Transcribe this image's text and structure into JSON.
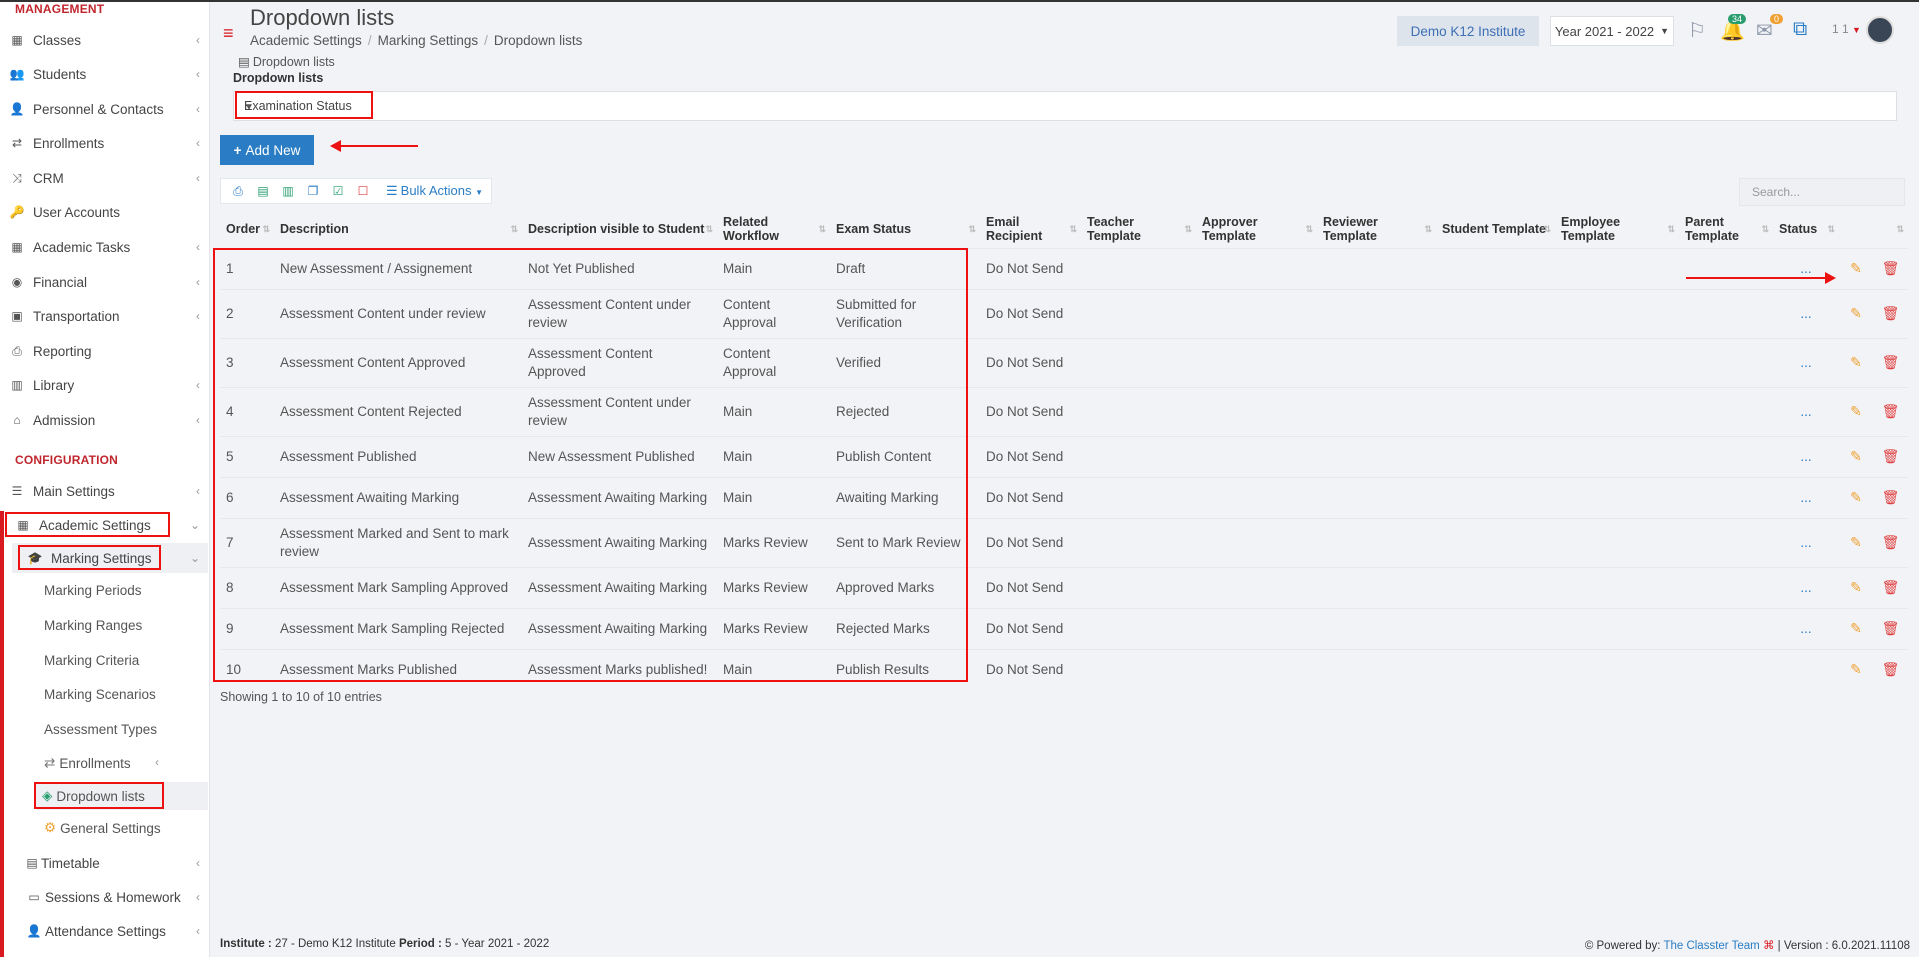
{
  "sidebar": {
    "management_title": "MANAGEMENT",
    "configuration_title": "CONFIGURATION",
    "items": [
      {
        "label": "Classes"
      },
      {
        "label": "Students"
      },
      {
        "label": "Personnel & Contacts"
      },
      {
        "label": "Enrollments"
      },
      {
        "label": "CRM"
      },
      {
        "label": "User Accounts"
      },
      {
        "label": "Academic Tasks"
      },
      {
        "label": "Financial"
      },
      {
        "label": "Transportation"
      },
      {
        "label": "Reporting"
      },
      {
        "label": "Library"
      },
      {
        "label": "Admission"
      }
    ],
    "config_items": [
      {
        "label": "Main Settings"
      },
      {
        "label": "Academic Settings"
      },
      {
        "label": "Marking Settings"
      },
      {
        "label": "Marking Periods"
      },
      {
        "label": "Marking Ranges"
      },
      {
        "label": "Marking Criteria"
      },
      {
        "label": "Marking Scenarios"
      },
      {
        "label": "Assessment Types"
      },
      {
        "label": "Enrollments"
      },
      {
        "label": "Dropdown lists"
      },
      {
        "label": "General Settings"
      },
      {
        "label": "Timetable"
      },
      {
        "label": "Sessions & Homework"
      },
      {
        "label": "Attendance Settings"
      }
    ]
  },
  "header": {
    "title": "Dropdown lists",
    "breadcrumb": [
      "Academic Settings",
      "Marking Settings",
      "Dropdown lists"
    ],
    "institute": "Demo K12 Institute",
    "year": "Year 2021 - 2022",
    "notifications_count": "34",
    "messages_count": "0",
    "user_number": "1 1"
  },
  "content": {
    "subhead": "Dropdown lists",
    "dropdown_label": "Dropdown lists",
    "dropdown_value": "Examination Status",
    "add_button": "Add New",
    "bulk_actions": "Bulk Actions",
    "search_placeholder": "Search...",
    "showing": "Showing 1 to 10 of 10 entries"
  },
  "table": {
    "columns": [
      "Order",
      "Description",
      "Description visible to Student",
      "Related Workflow",
      "Exam Status",
      "Email Recipient",
      "Teacher Template",
      "Approver Template",
      "Reviewer Template",
      "Student Template",
      "Employee Template",
      "Parent Template",
      "Status"
    ],
    "rows": [
      {
        "order": "1",
        "desc": "New Assessment / Assignement",
        "visible": "Not Yet Published",
        "workflow": "Main",
        "status": "Draft",
        "email": "Do Not Send",
        "dots": "..."
      },
      {
        "order": "2",
        "desc": "Assessment Content under review",
        "visible": "Assessment Content under review",
        "workflow": "Content Approval",
        "status": "Submitted for Verification",
        "email": "Do Not Send",
        "dots": "..."
      },
      {
        "order": "3",
        "desc": "Assessment Content Approved",
        "visible": "Assessment Content Approved",
        "workflow": "Content Approval",
        "status": "Verified",
        "email": "Do Not Send",
        "dots": "..."
      },
      {
        "order": "4",
        "desc": "Assessment Content Rejected",
        "visible": "Assessment Content under review",
        "workflow": "Main",
        "status": "Rejected",
        "email": "Do Not Send",
        "dots": "..."
      },
      {
        "order": "5",
        "desc": "Assessment Published",
        "visible": "New Assessment Published",
        "workflow": "Main",
        "status": "Publish Content",
        "email": "Do Not Send",
        "dots": "..."
      },
      {
        "order": "6",
        "desc": "Assessment Awaiting Marking",
        "visible": "Assessment Awaiting Marking",
        "workflow": "Main",
        "status": "Awaiting Marking",
        "email": "Do Not Send",
        "dots": "..."
      },
      {
        "order": "7",
        "desc": "Assessment Marked and Sent to mark review",
        "visible": "Assessment Awaiting Marking",
        "workflow": "Marks Review",
        "status": "Sent to Mark Review",
        "email": "Do Not Send",
        "dots": "..."
      },
      {
        "order": "8",
        "desc": "Assessment Mark Sampling Approved",
        "visible": "Assessment Awaiting Marking",
        "workflow": "Marks Review",
        "status": "Approved Marks",
        "email": "Do Not Send",
        "dots": "..."
      },
      {
        "order": "9",
        "desc": "Assessment Mark Sampling Rejected",
        "visible": "Assessment Awaiting Marking",
        "workflow": "Marks Review",
        "status": "Rejected Marks",
        "email": "Do Not Send",
        "dots": "..."
      },
      {
        "order": "10",
        "desc": "Assessment Marks Published",
        "visible": "Assessment Marks published!",
        "workflow": "Main",
        "status": "Publish Results",
        "email": "Do Not Send",
        "dots": ""
      }
    ]
  },
  "footer": {
    "institute_label": "Institute :",
    "institute_value": "27 - Demo K12 Institute",
    "period_label": "Period :",
    "period_value": "5 - Year 2021 - 2022",
    "powered_by": "Powered by:",
    "team": "The Classter Team",
    "version": "| Version : 6.0.2021.11108"
  }
}
